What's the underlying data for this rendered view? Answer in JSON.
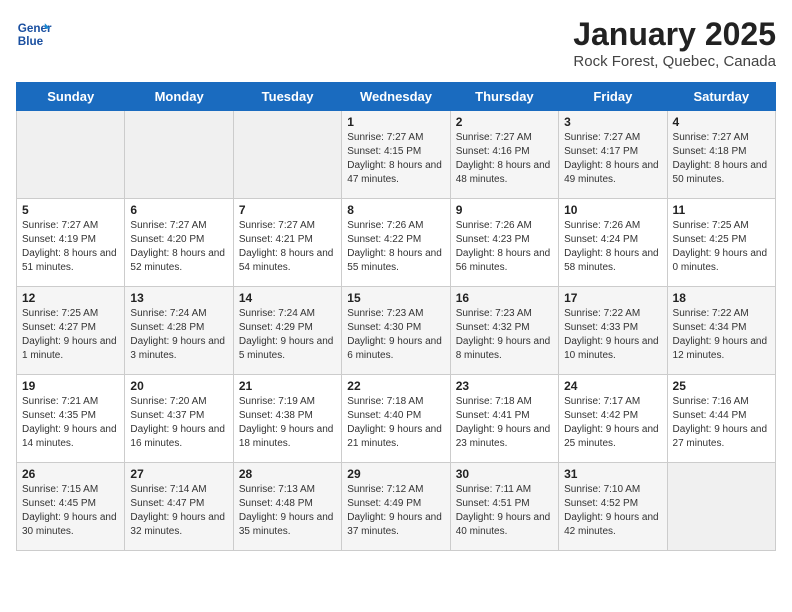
{
  "logo": {
    "line1": "General",
    "line2": "Blue"
  },
  "title": "January 2025",
  "subtitle": "Rock Forest, Quebec, Canada",
  "headers": [
    "Sunday",
    "Monday",
    "Tuesday",
    "Wednesday",
    "Thursday",
    "Friday",
    "Saturday"
  ],
  "weeks": [
    [
      {
        "day": "",
        "info": ""
      },
      {
        "day": "",
        "info": ""
      },
      {
        "day": "",
        "info": ""
      },
      {
        "day": "1",
        "info": "Sunrise: 7:27 AM\nSunset: 4:15 PM\nDaylight: 8 hours and 47 minutes."
      },
      {
        "day": "2",
        "info": "Sunrise: 7:27 AM\nSunset: 4:16 PM\nDaylight: 8 hours and 48 minutes."
      },
      {
        "day": "3",
        "info": "Sunrise: 7:27 AM\nSunset: 4:17 PM\nDaylight: 8 hours and 49 minutes."
      },
      {
        "day": "4",
        "info": "Sunrise: 7:27 AM\nSunset: 4:18 PM\nDaylight: 8 hours and 50 minutes."
      }
    ],
    [
      {
        "day": "5",
        "info": "Sunrise: 7:27 AM\nSunset: 4:19 PM\nDaylight: 8 hours and 51 minutes."
      },
      {
        "day": "6",
        "info": "Sunrise: 7:27 AM\nSunset: 4:20 PM\nDaylight: 8 hours and 52 minutes."
      },
      {
        "day": "7",
        "info": "Sunrise: 7:27 AM\nSunset: 4:21 PM\nDaylight: 8 hours and 54 minutes."
      },
      {
        "day": "8",
        "info": "Sunrise: 7:26 AM\nSunset: 4:22 PM\nDaylight: 8 hours and 55 minutes."
      },
      {
        "day": "9",
        "info": "Sunrise: 7:26 AM\nSunset: 4:23 PM\nDaylight: 8 hours and 56 minutes."
      },
      {
        "day": "10",
        "info": "Sunrise: 7:26 AM\nSunset: 4:24 PM\nDaylight: 8 hours and 58 minutes."
      },
      {
        "day": "11",
        "info": "Sunrise: 7:25 AM\nSunset: 4:25 PM\nDaylight: 9 hours and 0 minutes."
      }
    ],
    [
      {
        "day": "12",
        "info": "Sunrise: 7:25 AM\nSunset: 4:27 PM\nDaylight: 9 hours and 1 minute."
      },
      {
        "day": "13",
        "info": "Sunrise: 7:24 AM\nSunset: 4:28 PM\nDaylight: 9 hours and 3 minutes."
      },
      {
        "day": "14",
        "info": "Sunrise: 7:24 AM\nSunset: 4:29 PM\nDaylight: 9 hours and 5 minutes."
      },
      {
        "day": "15",
        "info": "Sunrise: 7:23 AM\nSunset: 4:30 PM\nDaylight: 9 hours and 6 minutes."
      },
      {
        "day": "16",
        "info": "Sunrise: 7:23 AM\nSunset: 4:32 PM\nDaylight: 9 hours and 8 minutes."
      },
      {
        "day": "17",
        "info": "Sunrise: 7:22 AM\nSunset: 4:33 PM\nDaylight: 9 hours and 10 minutes."
      },
      {
        "day": "18",
        "info": "Sunrise: 7:22 AM\nSunset: 4:34 PM\nDaylight: 9 hours and 12 minutes."
      }
    ],
    [
      {
        "day": "19",
        "info": "Sunrise: 7:21 AM\nSunset: 4:35 PM\nDaylight: 9 hours and 14 minutes."
      },
      {
        "day": "20",
        "info": "Sunrise: 7:20 AM\nSunset: 4:37 PM\nDaylight: 9 hours and 16 minutes."
      },
      {
        "day": "21",
        "info": "Sunrise: 7:19 AM\nSunset: 4:38 PM\nDaylight: 9 hours and 18 minutes."
      },
      {
        "day": "22",
        "info": "Sunrise: 7:18 AM\nSunset: 4:40 PM\nDaylight: 9 hours and 21 minutes."
      },
      {
        "day": "23",
        "info": "Sunrise: 7:18 AM\nSunset: 4:41 PM\nDaylight: 9 hours and 23 minutes."
      },
      {
        "day": "24",
        "info": "Sunrise: 7:17 AM\nSunset: 4:42 PM\nDaylight: 9 hours and 25 minutes."
      },
      {
        "day": "25",
        "info": "Sunrise: 7:16 AM\nSunset: 4:44 PM\nDaylight: 9 hours and 27 minutes."
      }
    ],
    [
      {
        "day": "26",
        "info": "Sunrise: 7:15 AM\nSunset: 4:45 PM\nDaylight: 9 hours and 30 minutes."
      },
      {
        "day": "27",
        "info": "Sunrise: 7:14 AM\nSunset: 4:47 PM\nDaylight: 9 hours and 32 minutes."
      },
      {
        "day": "28",
        "info": "Sunrise: 7:13 AM\nSunset: 4:48 PM\nDaylight: 9 hours and 35 minutes."
      },
      {
        "day": "29",
        "info": "Sunrise: 7:12 AM\nSunset: 4:49 PM\nDaylight: 9 hours and 37 minutes."
      },
      {
        "day": "30",
        "info": "Sunrise: 7:11 AM\nSunset: 4:51 PM\nDaylight: 9 hours and 40 minutes."
      },
      {
        "day": "31",
        "info": "Sunrise: 7:10 AM\nSunset: 4:52 PM\nDaylight: 9 hours and 42 minutes."
      },
      {
        "day": "",
        "info": ""
      }
    ]
  ]
}
